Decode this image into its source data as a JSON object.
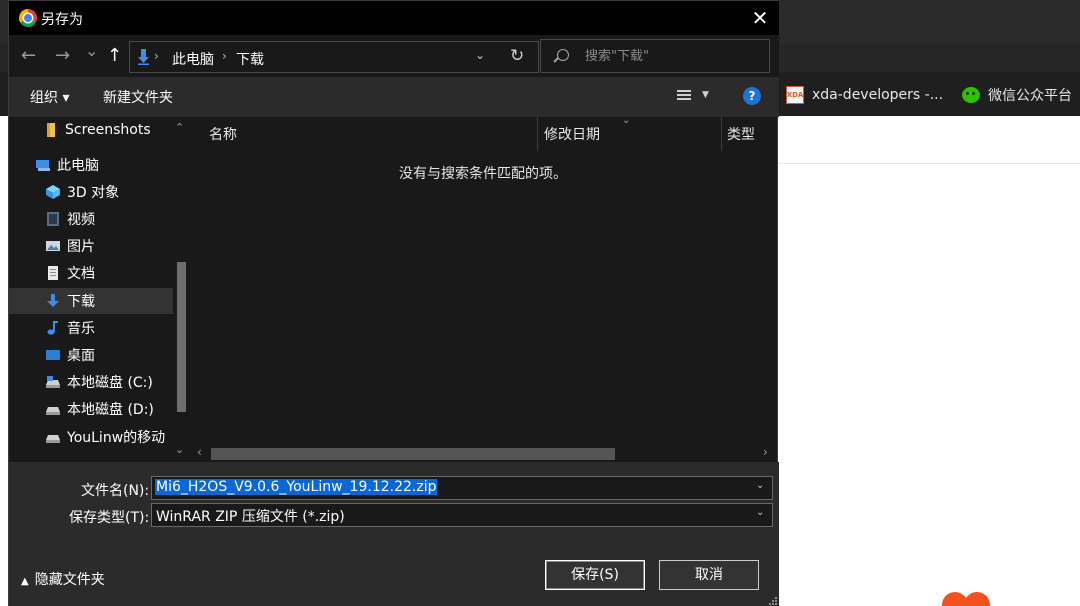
{
  "dialog": {
    "title": "另存为",
    "close_glyph": "✕"
  },
  "nav": {
    "back_glyph": "←",
    "forward_glyph": "→",
    "recent_glyph": "⌄",
    "up_glyph": "↑",
    "breadcrumb": [
      "此电脑",
      "下载"
    ],
    "separator": "›",
    "dropdown_glyph": "⌄",
    "refresh_glyph": "↻",
    "search_placeholder": "搜索\"下载\""
  },
  "toolbar": {
    "organize_label": "组织 ▾",
    "new_folder_label": "新建文件夹",
    "help_glyph": "?"
  },
  "sidebar": {
    "items": [
      {
        "label": "Screenshots",
        "icon": "folder-icon"
      },
      {
        "label": "此电脑",
        "icon": "computer-icon"
      },
      {
        "label": "3D 对象",
        "icon": "3d-objects-icon"
      },
      {
        "label": "视频",
        "icon": "video-icon"
      },
      {
        "label": "图片",
        "icon": "pictures-icon"
      },
      {
        "label": "文档",
        "icon": "document-icon"
      },
      {
        "label": "下载",
        "icon": "download-icon"
      },
      {
        "label": "音乐",
        "icon": "music-icon"
      },
      {
        "label": "桌面",
        "icon": "desktop-icon"
      },
      {
        "label": "本地磁盘 (C:)",
        "icon": "drive-icon"
      },
      {
        "label": "本地磁盘 (D:)",
        "icon": "drive-icon"
      },
      {
        "label": "YouLinw的移动",
        "icon": "removable-drive-icon"
      }
    ],
    "selected_index": 6
  },
  "file_list": {
    "columns": [
      "名称",
      "修改日期",
      "类型"
    ],
    "empty_message": "没有与搜索条件匹配的项。"
  },
  "fields": {
    "filename_label": "文件名(N):",
    "filename_value": "Mi6_H2OS_V9.0.6_YouLinw_19.12.22.zip",
    "filetype_label": "保存类型(T):",
    "filetype_value": "WinRAR ZIP 压缩文件 (*.zip)"
  },
  "footer": {
    "hide_folders_label": "隐藏文件夹",
    "save_label": "保存(S)",
    "cancel_label": "取消"
  },
  "browser": {
    "bookmarks": [
      {
        "label": "xda-developers -...",
        "icon": "xda-icon"
      },
      {
        "label": "微信公众平台",
        "icon": "wechat-icon"
      }
    ],
    "xda_icon_text": "XDA"
  },
  "colors": {
    "accent": "#0b66d6",
    "dialog_bg": "#2b2b2b",
    "pane_bg": "#191919",
    "titlebar_bg": "#000000"
  }
}
